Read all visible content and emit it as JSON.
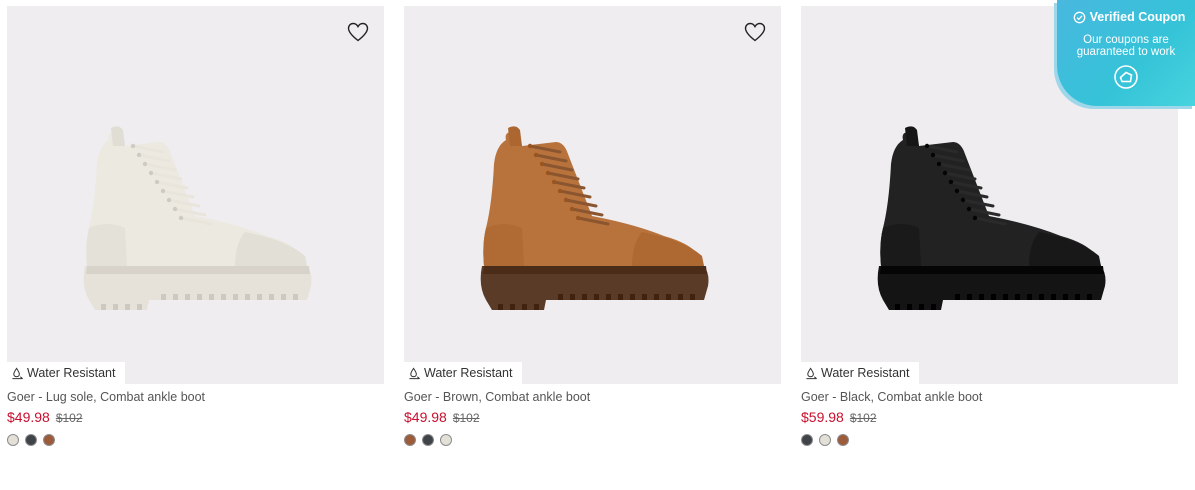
{
  "products": [
    {
      "badge": "Water Resistant",
      "name": "Goer - Lug sole, Combat ankle boot",
      "sale_price": "$49.98",
      "original_price": "$102",
      "boot_color": "#ece9e1",
      "sole_color": "#e6e2d9",
      "lace_color": "#e9e5dc",
      "swatches": [
        "#e3e0d8",
        "#404449",
        "#9c5c3b"
      ]
    },
    {
      "badge": "Water Resistant",
      "name": "Goer - Brown, Combat ankle boot",
      "sale_price": "$49.98",
      "original_price": "$102",
      "boot_color": "#b8733c",
      "sole_color": "#5a3b28",
      "lace_color": "#8b5530",
      "swatches": [
        "#9c5c3b",
        "#404449",
        "#e3e0d8"
      ]
    },
    {
      "badge": "Water Resistant",
      "name": "Goer - Black, Combat ankle boot",
      "sale_price": "$59.98",
      "original_price": "$102",
      "boot_color": "#222222",
      "sole_color": "#141414",
      "lace_color": "#2a2a2a",
      "swatches": [
        "#404449",
        "#e3e0d8",
        "#9c5c3b"
      ]
    }
  ],
  "coupon": {
    "title": "Verified Coupon",
    "subtitle": "Our coupons are guaranteed to work"
  }
}
